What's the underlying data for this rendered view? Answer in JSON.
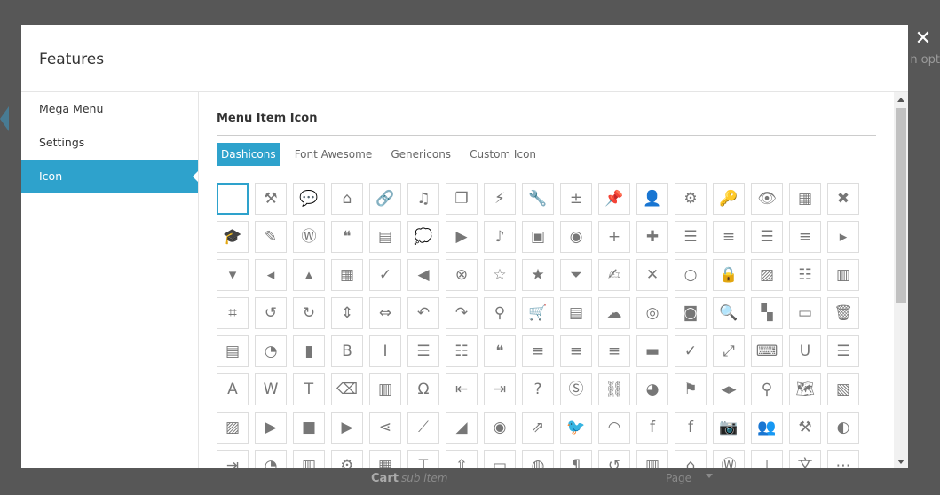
{
  "background": {
    "side_text": "n opt",
    "cart_label": "Cart",
    "cart_sub": "sub item",
    "page_label": "Page"
  },
  "modal": {
    "title": "Features",
    "close_glyph": "✕"
  },
  "sidebar": {
    "items": [
      {
        "label": "Mega Menu"
      },
      {
        "label": "Settings"
      },
      {
        "label": "Icon"
      }
    ]
  },
  "content": {
    "section_title": "Menu Item Icon",
    "tabs": [
      {
        "label": "Dashicons"
      },
      {
        "label": "Font Awesome"
      },
      {
        "label": "Genericons"
      },
      {
        "label": "Custom Icon"
      }
    ]
  },
  "icons": [
    [
      "none-icon",
      "hammer-icon",
      "comment-icon",
      "home-icon",
      "link-icon",
      "media-icon",
      "copy-icon",
      "plugin-icon",
      "wrench-icon",
      "plus-minus-icon",
      "pin-icon",
      "user-icon",
      "gear-icon",
      "key-icon",
      "preview-icon",
      "layout-icon",
      "dismiss-comment-icon"
    ],
    [
      "graduation-cap-icon",
      "edit-icon",
      "wordpress-icon",
      "quote-icon",
      "page-icon",
      "chat-icon",
      "video-icon",
      "music-icon",
      "image-icon",
      "bubble-icon",
      "plus-icon",
      "new-page-icon",
      "align-center-icon",
      "align-right-icon",
      "align-justify-icon",
      "align-left-icon",
      "arrow-right-icon"
    ],
    [
      "arrow-down-icon",
      "arrow-left-icon",
      "arrow-up-icon",
      "calendar-icon",
      "check-icon",
      "back-icon",
      "dismiss-icon",
      "star-empty-icon",
      "star-filled-icon",
      "toggle-icon",
      "edit-page-icon",
      "close-icon",
      "circle-icon",
      "lock-icon",
      "gallery-icon",
      "list-icon",
      "film-strip-icon"
    ],
    [
      "crop-icon",
      "rotate-left-icon",
      "rotate-right-icon",
      "flip-vertical-icon",
      "flip-horizontal-icon",
      "undo-icon",
      "redo-icon",
      "location-pin-icon",
      "cart-icon",
      "feedback-icon",
      "cloud-icon",
      "visibility-icon",
      "vault-icon",
      "search-icon",
      "grid-icon",
      "tickets-icon",
      "trash-icon"
    ],
    [
      "id-card-icon",
      "pie-chart-icon",
      "bar-chart-icon",
      "bold-icon",
      "italic-icon",
      "ul-list-icon",
      "ol-list-icon",
      "blockquote-icon",
      "text-left-icon",
      "text-center-icon",
      "text-right-icon",
      "more-icon",
      "spellcheck-icon",
      "fullscreen-icon",
      "keyboard-icon",
      "underline-icon",
      "justify-icon"
    ],
    [
      "text-color-icon",
      "paste-word-icon",
      "paste-text-icon",
      "eraser-icon",
      "omega-icon",
      "omega-char-icon",
      "outdent-icon",
      "indent-icon",
      "help-icon",
      "strikethrough-icon",
      "unlink-icon",
      "dashboard-icon",
      "flag-icon",
      "code-arrows-icon",
      "map-pin-icon",
      "map-book-icon",
      "gallery-stack-icon"
    ],
    [
      "media-stack-icon",
      "video-alt-icon",
      "camera-video-icon",
      "play-icon",
      "share-icon",
      "chart-line-icon",
      "chart-area-icon",
      "eye-sync-icon",
      "share-box-icon",
      "twitter-icon",
      "rss-icon",
      "facebook-square-icon",
      "facebook-icon",
      "camera-icon",
      "groups-icon",
      "hammer-alt-icon",
      "art-icon"
    ],
    [
      "migrate-icon",
      "performance-icon",
      "store-icon",
      "gear-alt-icon",
      "screen-options-icon",
      "text-box-icon",
      "upload-icon",
      "folder-icon",
      "globe-icon",
      "paragraph-icon",
      "history-icon",
      "portfolio-icon",
      "tag-icon",
      "wordpress-alt-icon",
      "networking-icon",
      "translation-icon",
      "ellipsis-icon"
    ]
  ]
}
